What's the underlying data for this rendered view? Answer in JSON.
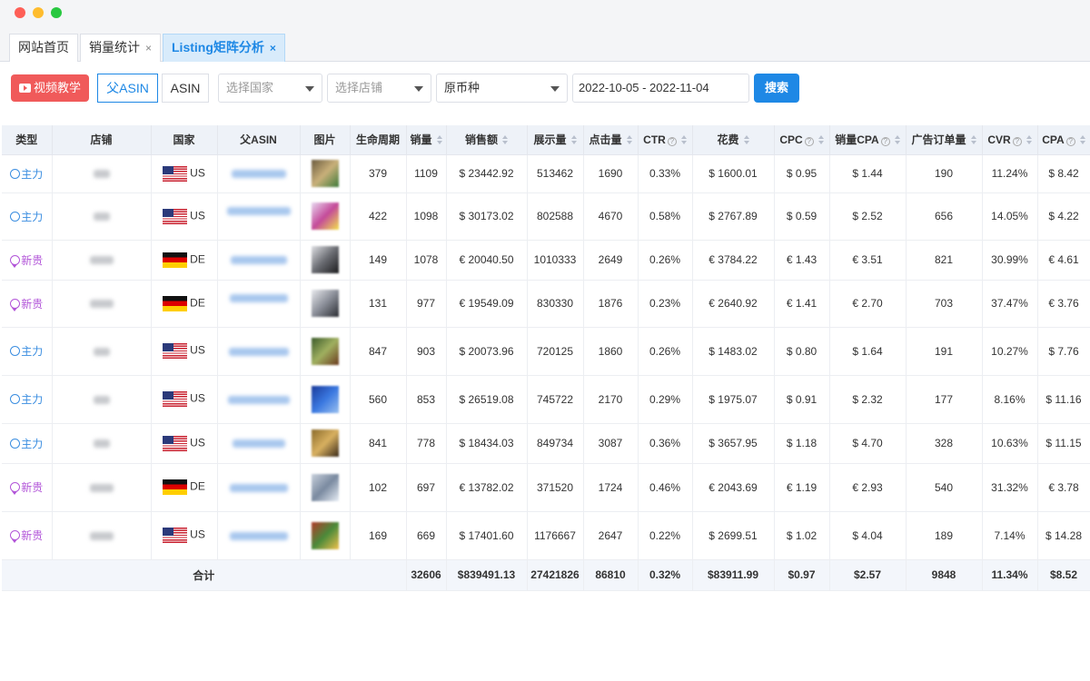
{
  "tabs": [
    {
      "label": "网站首页",
      "closable": false
    },
    {
      "label": "销量统计",
      "closable": true
    },
    {
      "label": "Listing矩阵分析",
      "closable": true
    }
  ],
  "close_glyph": "×",
  "toolbar": {
    "video_button": "视频教学",
    "seg_parent_asin": "父ASIN",
    "seg_asin": "ASIN",
    "country_placeholder": "选择国家",
    "store_placeholder": "选择店铺",
    "currency_value": "原币种",
    "date_range": "2022-10-05 - 2022-11-04",
    "search_button": "搜索"
  },
  "table": {
    "headers": {
      "type": "类型",
      "store": "店铺",
      "country": "国家",
      "parent_asin": "父ASIN",
      "image": "图片",
      "lifecycle": "生命周期",
      "units": "销量",
      "sales": "销售额",
      "impressions": "展示量",
      "clicks": "点击量",
      "ctr": "CTR",
      "spend": "花费",
      "cpc": "CPC",
      "sales_cpa": "销量CPA",
      "ad_orders": "广告订单量",
      "cvr": "CVR",
      "cpa": "CPA"
    },
    "rows": [
      {
        "type": "主力",
        "kind": "main",
        "country": "US",
        "lifecycle": "379",
        "units": "1109",
        "sales": "$ 23442.92",
        "impressions": "513462",
        "clicks": "1690",
        "ctr": "0.33%",
        "spend": "$ 1600.01",
        "cpc": "$ 0.95",
        "sales_cpa": "$ 1.44",
        "ad_orders": "190",
        "cvr": "11.24%",
        "cpa": "$ 8.42"
      },
      {
        "type": "主力",
        "kind": "main",
        "country": "US",
        "lifecycle": "422",
        "units": "1098",
        "sales": "$ 30173.02",
        "impressions": "802588",
        "clicks": "4670",
        "ctr": "0.58%",
        "spend": "$ 2767.89",
        "cpc": "$ 0.59",
        "sales_cpa": "$ 2.52",
        "ad_orders": "656",
        "cvr": "14.05%",
        "cpa": "$ 4.22"
      },
      {
        "type": "新贵",
        "kind": "new",
        "country": "DE",
        "lifecycle": "149",
        "units": "1078",
        "sales": "€ 20040.50",
        "impressions": "1010333",
        "clicks": "2649",
        "ctr": "0.26%",
        "spend": "€ 3784.22",
        "cpc": "€ 1.43",
        "sales_cpa": "€ 3.51",
        "ad_orders": "821",
        "cvr": "30.99%",
        "cpa": "€ 4.61"
      },
      {
        "type": "新贵",
        "kind": "new",
        "country": "DE",
        "lifecycle": "131",
        "units": "977",
        "sales": "€ 19549.09",
        "impressions": "830330",
        "clicks": "1876",
        "ctr": "0.23%",
        "spend": "€ 2640.92",
        "cpc": "€ 1.41",
        "sales_cpa": "€ 2.70",
        "ad_orders": "703",
        "cvr": "37.47%",
        "cpa": "€ 3.76"
      },
      {
        "type": "主力",
        "kind": "main",
        "country": "US",
        "lifecycle": "847",
        "units": "903",
        "sales": "$ 20073.96",
        "impressions": "720125",
        "clicks": "1860",
        "ctr": "0.26%",
        "spend": "$ 1483.02",
        "cpc": "$ 0.80",
        "sales_cpa": "$ 1.64",
        "ad_orders": "191",
        "cvr": "10.27%",
        "cpa": "$ 7.76"
      },
      {
        "type": "主力",
        "kind": "main",
        "country": "US",
        "lifecycle": "560",
        "units": "853",
        "sales": "$ 26519.08",
        "impressions": "745722",
        "clicks": "2170",
        "ctr": "0.29%",
        "spend": "$ 1975.07",
        "cpc": "$ 0.91",
        "sales_cpa": "$ 2.32",
        "ad_orders": "177",
        "cvr": "8.16%",
        "cpa": "$ 11.16"
      },
      {
        "type": "主力",
        "kind": "main",
        "country": "US",
        "lifecycle": "841",
        "units": "778",
        "sales": "$ 18434.03",
        "impressions": "849734",
        "clicks": "3087",
        "ctr": "0.36%",
        "spend": "$ 3657.95",
        "cpc": "$ 1.18",
        "sales_cpa": "$ 4.70",
        "ad_orders": "328",
        "cvr": "10.63%",
        "cpa": "$ 11.15"
      },
      {
        "type": "新贵",
        "kind": "new",
        "country": "DE",
        "lifecycle": "102",
        "units": "697",
        "sales": "€ 13782.02",
        "impressions": "371520",
        "clicks": "1724",
        "ctr": "0.46%",
        "spend": "€ 2043.69",
        "cpc": "€ 1.19",
        "sales_cpa": "€ 2.93",
        "ad_orders": "540",
        "cvr": "31.32%",
        "cpa": "€ 3.78"
      },
      {
        "type": "新贵",
        "kind": "new",
        "country": "US",
        "lifecycle": "169",
        "units": "669",
        "sales": "$ 17401.60",
        "impressions": "1176667",
        "clicks": "2647",
        "ctr": "0.22%",
        "spend": "$ 2699.51",
        "cpc": "$ 1.02",
        "sales_cpa": "$ 4.04",
        "ad_orders": "189",
        "cvr": "7.14%",
        "cpa": "$ 14.28"
      }
    ],
    "total": {
      "label": "合计",
      "units": "32606",
      "sales": "$839491.13",
      "impressions": "27421826",
      "clicks": "86810",
      "ctr": "0.32%",
      "spend": "$83911.99",
      "cpc": "$0.97",
      "sales_cpa": "$2.57",
      "ad_orders": "9848",
      "cvr": "11.34%",
      "cpa": "$8.52"
    }
  },
  "colors": {
    "accent": "#1e88e5",
    "video_button": "#f05a5a",
    "type_main": "#3a8de0",
    "type_new": "#b255d8",
    "header_bg": "#eef2f8"
  },
  "icons": {
    "type_main": "target-circle-icon",
    "type_new": "award-badge-icon",
    "video": "play-icon",
    "sort": "sort-caret-icon",
    "help": "question-circle-icon"
  }
}
